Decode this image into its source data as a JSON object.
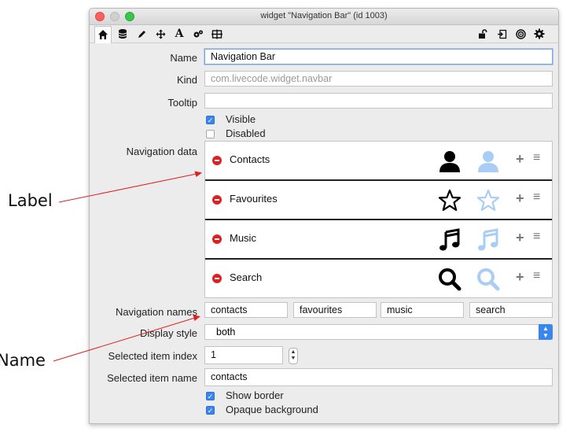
{
  "window": {
    "title": "widget \"Navigation Bar\" (id 1003)"
  },
  "toolbar": {
    "left": [
      "home-icon",
      "database-icon",
      "pencil-icon",
      "move-icon",
      "text-icon",
      "gears-icon",
      "grid-icon"
    ],
    "right": [
      "lock-icon",
      "exit-icon",
      "target-icon",
      "gear-icon"
    ]
  },
  "props": {
    "name_label": "Name",
    "name_value": "Navigation Bar",
    "kind_label": "Kind",
    "kind_value": "com.livecode.widget.navbar",
    "tooltip_label": "Tooltip",
    "tooltip_value": "",
    "visible_label": "Visible",
    "visible_checked": true,
    "disabled_label": "Disabled",
    "disabled_checked": false,
    "navdata_label": "Navigation data",
    "navnames_label": "Navigation names",
    "display_label": "Display style",
    "display_value": "both",
    "index_label": "Selected item index",
    "index_value": "1",
    "selname_label": "Selected item name",
    "selname_value": "contacts",
    "border_label": "Show border",
    "border_checked": true,
    "opaque_label": "Opaque background",
    "opaque_checked": true
  },
  "nav_items": [
    {
      "label": "Contacts",
      "icon": "user-icon"
    },
    {
      "label": "Favourites",
      "icon": "star-icon"
    },
    {
      "label": "Music",
      "icon": "music-icon"
    },
    {
      "label": "Search",
      "icon": "search-icon"
    }
  ],
  "nav_names": [
    "contacts",
    "favourites",
    "music",
    "search"
  ],
  "annotations": {
    "label": "Label",
    "name": "Name"
  },
  "colors": {
    "accent": "#3b86ec",
    "selected_icon": "#a9cdf5",
    "remove": "#e02020",
    "arrow": "#e02020"
  }
}
